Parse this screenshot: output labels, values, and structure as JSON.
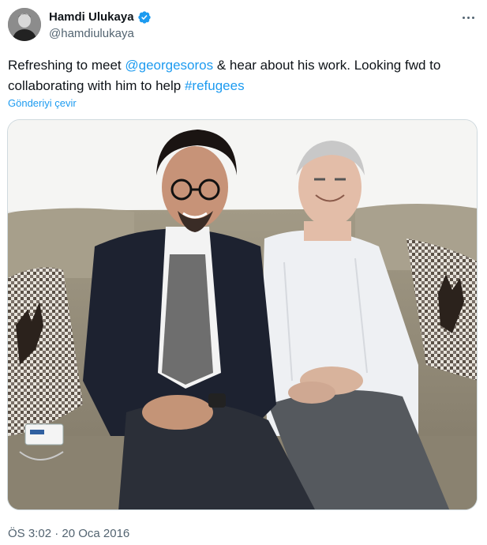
{
  "author": {
    "display_name": "Hamdi Ulukaya",
    "handle": "@hamdiulukaya",
    "verified": true,
    "avatar_icon": "user-avatar"
  },
  "tweet": {
    "text_before": "Refreshing to meet ",
    "mention": "@georgesoros",
    "text_middle": " & hear about his work. Looking fwd to collaborating with him to help ",
    "hashtag": "#refugees",
    "translate_label": "Gönderiyi çevir",
    "timestamp": "ÖS 3:02 · 20 Oca 2016"
  },
  "media": {
    "description_icon": "photo-image"
  },
  "colors": {
    "link": "#1d9bf0",
    "secondary_text": "#536471",
    "verified": "#1d9bf0",
    "border": "#cfd9de"
  }
}
